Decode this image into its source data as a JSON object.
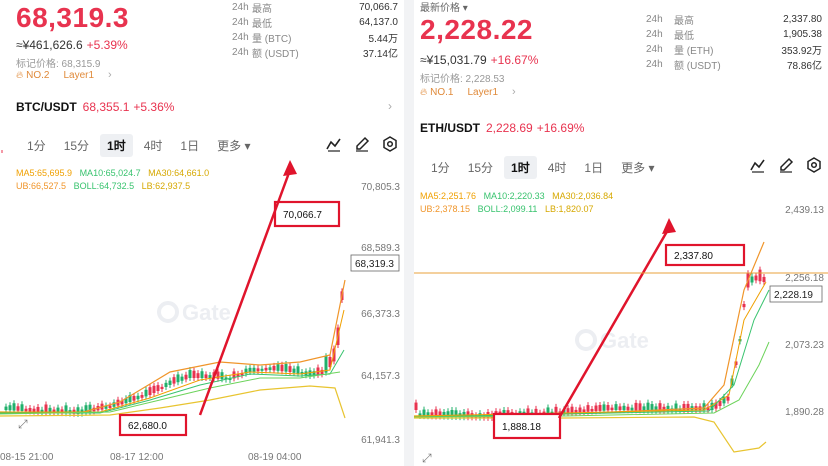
{
  "colors": {
    "up": "#e8334f",
    "down": "#21b06b",
    "annotation": "#e0142c",
    "ma5": "#f0a000",
    "ma10": "#38c36e",
    "ma30": "#e3c300",
    "boll": "#6cd35a",
    "ub": "#f0952a",
    "lb": "#e8c430"
  },
  "left": {
    "price": "68,319.3",
    "cny": "≈¥461,626.6",
    "change": "+5.39%",
    "mark_price": "标记价格: 68,315.9",
    "rank": "NO.2",
    "tag": "Layer1",
    "stats": [
      {
        "period": "24h",
        "label": "最高",
        "value": "70,066.7"
      },
      {
        "period": "24h",
        "label": "最低",
        "value": "64,137.0"
      },
      {
        "period": "24h",
        "label": "量 (BTC)",
        "value": "5.44万"
      },
      {
        "period": "24h",
        "label": "额 (USDT)",
        "value": "37.14亿"
      }
    ],
    "pair": "BTC/USDT",
    "pair_price": "68,355.1",
    "pair_change": "+5.36%",
    "tabs": [
      "1分",
      "15分",
      "1时",
      "4时",
      "1日",
      "更多 ▾"
    ],
    "ma_row1": [
      "MA5:65,695.9",
      "MA10:65,024.7",
      "MA30:64,661.0"
    ],
    "ma_row2": [
      "UB:66,527.5",
      "BOLL:64,732.5",
      "LB:62,937.5"
    ],
    "y_ticks": [
      "70,805.3",
      "68,589.3",
      "66,373.3",
      "64,157.3",
      "61,941.3"
    ],
    "x_ticks": [
      "08-15 21:00",
      "08-17 12:00",
      "08-19 04:00"
    ],
    "current_label": "68,319.3",
    "high_box": "70,066.7",
    "low_box": "62,680.0",
    "watermark": "Gate"
  },
  "right": {
    "latest_label": "最新价格 ▾",
    "price": "2,228.22",
    "cny": "≈¥15,031.79",
    "change": "+16.67%",
    "mark_price": "标记价格: 2,228.53",
    "rank": "NO.1",
    "tag": "Layer1",
    "stats": [
      {
        "period": "24h",
        "label": "最高",
        "value": "2,337.80"
      },
      {
        "period": "24h",
        "label": "最低",
        "value": "1,905.38"
      },
      {
        "period": "24h",
        "label": "量 (ETH)",
        "value": "353.92万"
      },
      {
        "period": "24h",
        "label": "额 (USDT)",
        "value": "78.86亿"
      }
    ],
    "pair": "ETH/USDT",
    "pair_price": "2,228.69",
    "pair_change": "+16.69%",
    "tabs": [
      "1分",
      "15分",
      "1时",
      "4时",
      "1日",
      "更多 ▾"
    ],
    "ma_row1": [
      "MA5:2,251.76",
      "MA10:2,220.33",
      "MA30:2,036.84"
    ],
    "ma_row2": [
      "UB:2,378.15",
      "BOLL:2,099.11",
      "LB:1,820.07"
    ],
    "y_ticks": [
      "2,439.13",
      "2,256.18",
      "2,073.23",
      "1,890.28"
    ],
    "current_label": "2,228.19",
    "high_box": "2,337.80",
    "low_box": "1,888.18",
    "watermark": "Gate"
  }
}
